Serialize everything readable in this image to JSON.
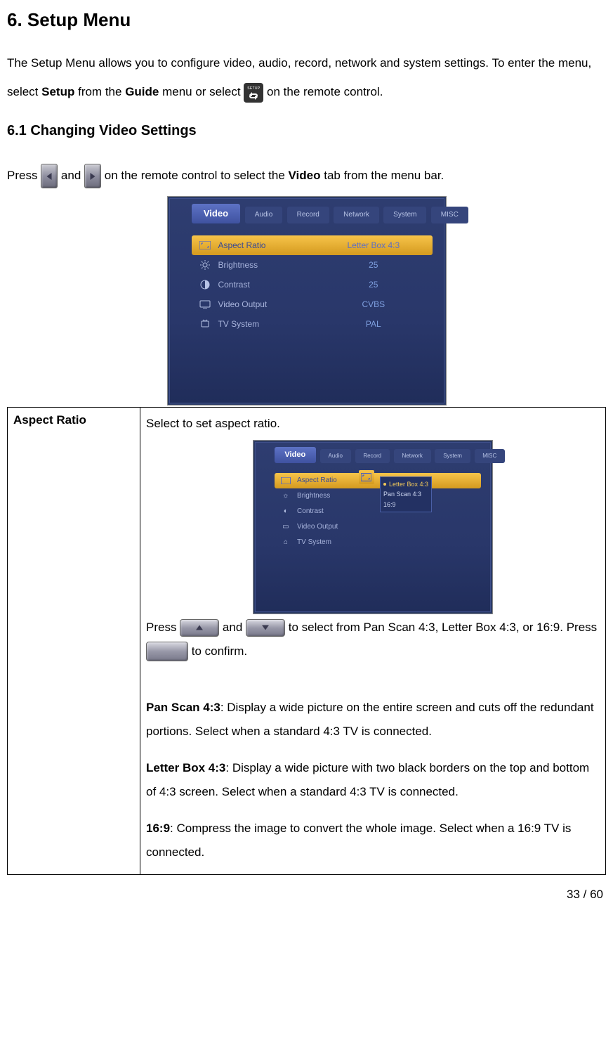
{
  "h1": "6. Setup Menu",
  "intro_1": "The Setup Menu allows you to configure video, audio, record, network and system settings. To enter the menu, select ",
  "intro_b1": "Setup",
  "intro_2": " from the ",
  "intro_b2": "Guide",
  "intro_3": " menu or select ",
  "intro_4": " on the remote control.",
  "h2": "6.1 Changing Video Settings",
  "press_1": "Press ",
  "press_and": " and ",
  "press_2": " on the remote control to select the ",
  "press_b": "Video",
  "press_3": " tab from the menu bar.",
  "tabs": [
    "Video",
    "Audio",
    "Record",
    "Network",
    "System",
    "MISC"
  ],
  "rows": [
    {
      "label": "Aspect Ratio",
      "value": "Letter Box 4:3"
    },
    {
      "label": "Brightness",
      "value": "25"
    },
    {
      "label": "Contrast",
      "value": "25"
    },
    {
      "label": "Video Output",
      "value": "CVBS"
    },
    {
      "label": "TV System",
      "value": "PAL"
    }
  ],
  "popup_items": [
    "Letter Box 4:3",
    "Pan Scan 4:3",
    "16:9"
  ],
  "table": {
    "key": "Aspect Ratio",
    "top_line": "Select to set aspect ratio.",
    "press_a": "Press ",
    "press_b": " and ",
    "press_c": " to select from Pan Scan 4:3, Letter Box 4:3, or 16:9. Press ",
    "press_d": " to confirm.",
    "pan_b": "Pan Scan 4:3",
    "pan_t": ": Display a wide picture on the entire screen and cuts off the redundant portions. Select when a standard 4:3 TV is connected.",
    "lb_b": "Letter Box 4:3",
    "lb_t": ": Display a wide picture with two black borders on the top and bottom of 4:3 screen. Select when a standard 4:3 TV is connected.",
    "x_b": "16:9",
    "x_t": ": Compress the image to convert the whole image. Select when a 16:9 TV is connected."
  },
  "page": "33 / 60"
}
